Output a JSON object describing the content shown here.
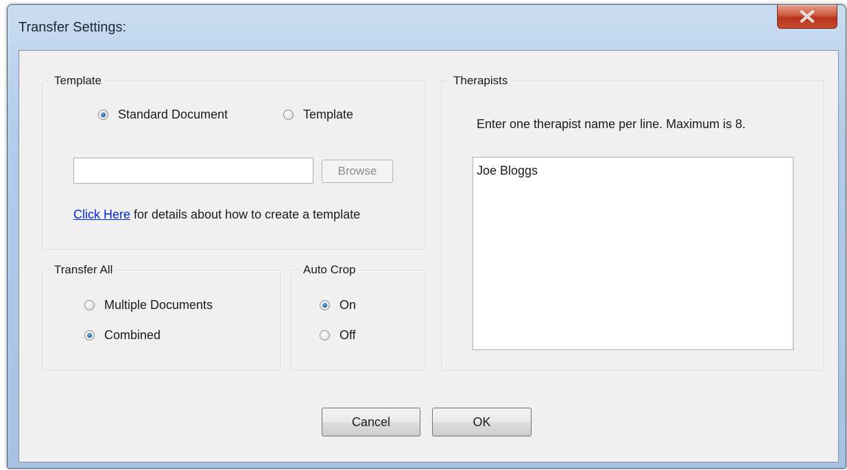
{
  "window": {
    "title": "Transfer Settings:"
  },
  "template_group": {
    "label": "Template",
    "radio_standard": "Standard Document",
    "radio_template": "Template",
    "selected": "Standard Document",
    "path_value": "",
    "browse_label": "Browse",
    "link_text": "Click Here",
    "link_suffix": " for details about how to create a template"
  },
  "transfer_all_group": {
    "label": "Transfer All",
    "radio_multiple": "Multiple Documents",
    "radio_combined": "Combined",
    "selected": "Combined"
  },
  "auto_crop_group": {
    "label": "Auto Crop",
    "radio_on": "On",
    "radio_off": "Off",
    "selected": "On"
  },
  "therapists_group": {
    "label": "Therapists",
    "instruction": "Enter one therapist name per line. Maximum is 8.",
    "names_value": "Joe Bloggs"
  },
  "buttons": {
    "cancel_label": "Cancel",
    "ok_label": "OK"
  },
  "colors": {
    "title_bar": "#b3cbe8",
    "close_button": "#c94a30",
    "client_background": "#f0f0f0",
    "link": "#0026e0"
  },
  "icons": {
    "close": "close-icon"
  }
}
